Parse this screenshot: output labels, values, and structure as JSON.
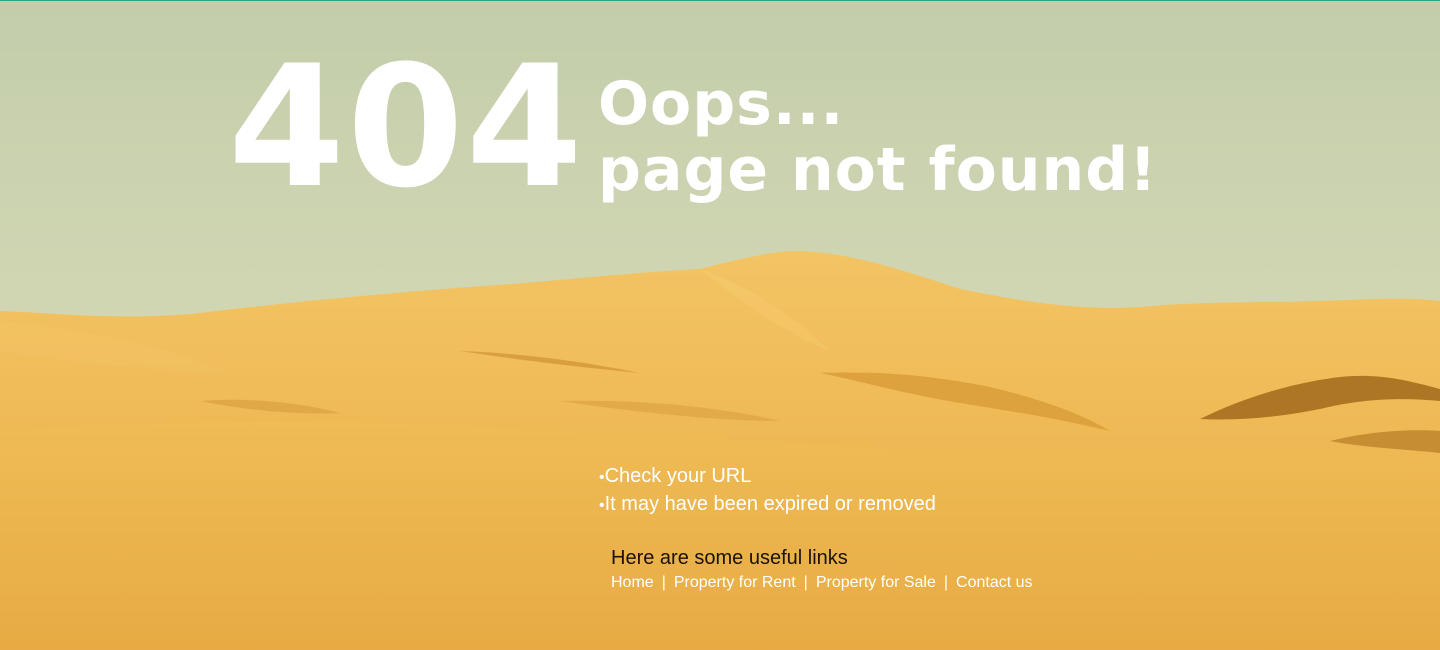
{
  "error": {
    "code": "404",
    "line1": "Oops...",
    "line2": "page not found!"
  },
  "tips": [
    "Check your URL",
    "It may have been expired or removed"
  ],
  "links_heading": "Here are some useful links",
  "links": [
    {
      "label": "Home"
    },
    {
      "label": "Property for Rent"
    },
    {
      "label": "Property for Sale"
    },
    {
      "label": "Contact us"
    }
  ],
  "separator": "|",
  "colors": {
    "top_border": "#2aa58c",
    "sky_top": "#c5cfad",
    "sky_bottom": "#dfe0bb",
    "sand_light": "#f2c463",
    "sand_mid": "#e7a83a",
    "sand_shadow": "#a86b1d"
  }
}
